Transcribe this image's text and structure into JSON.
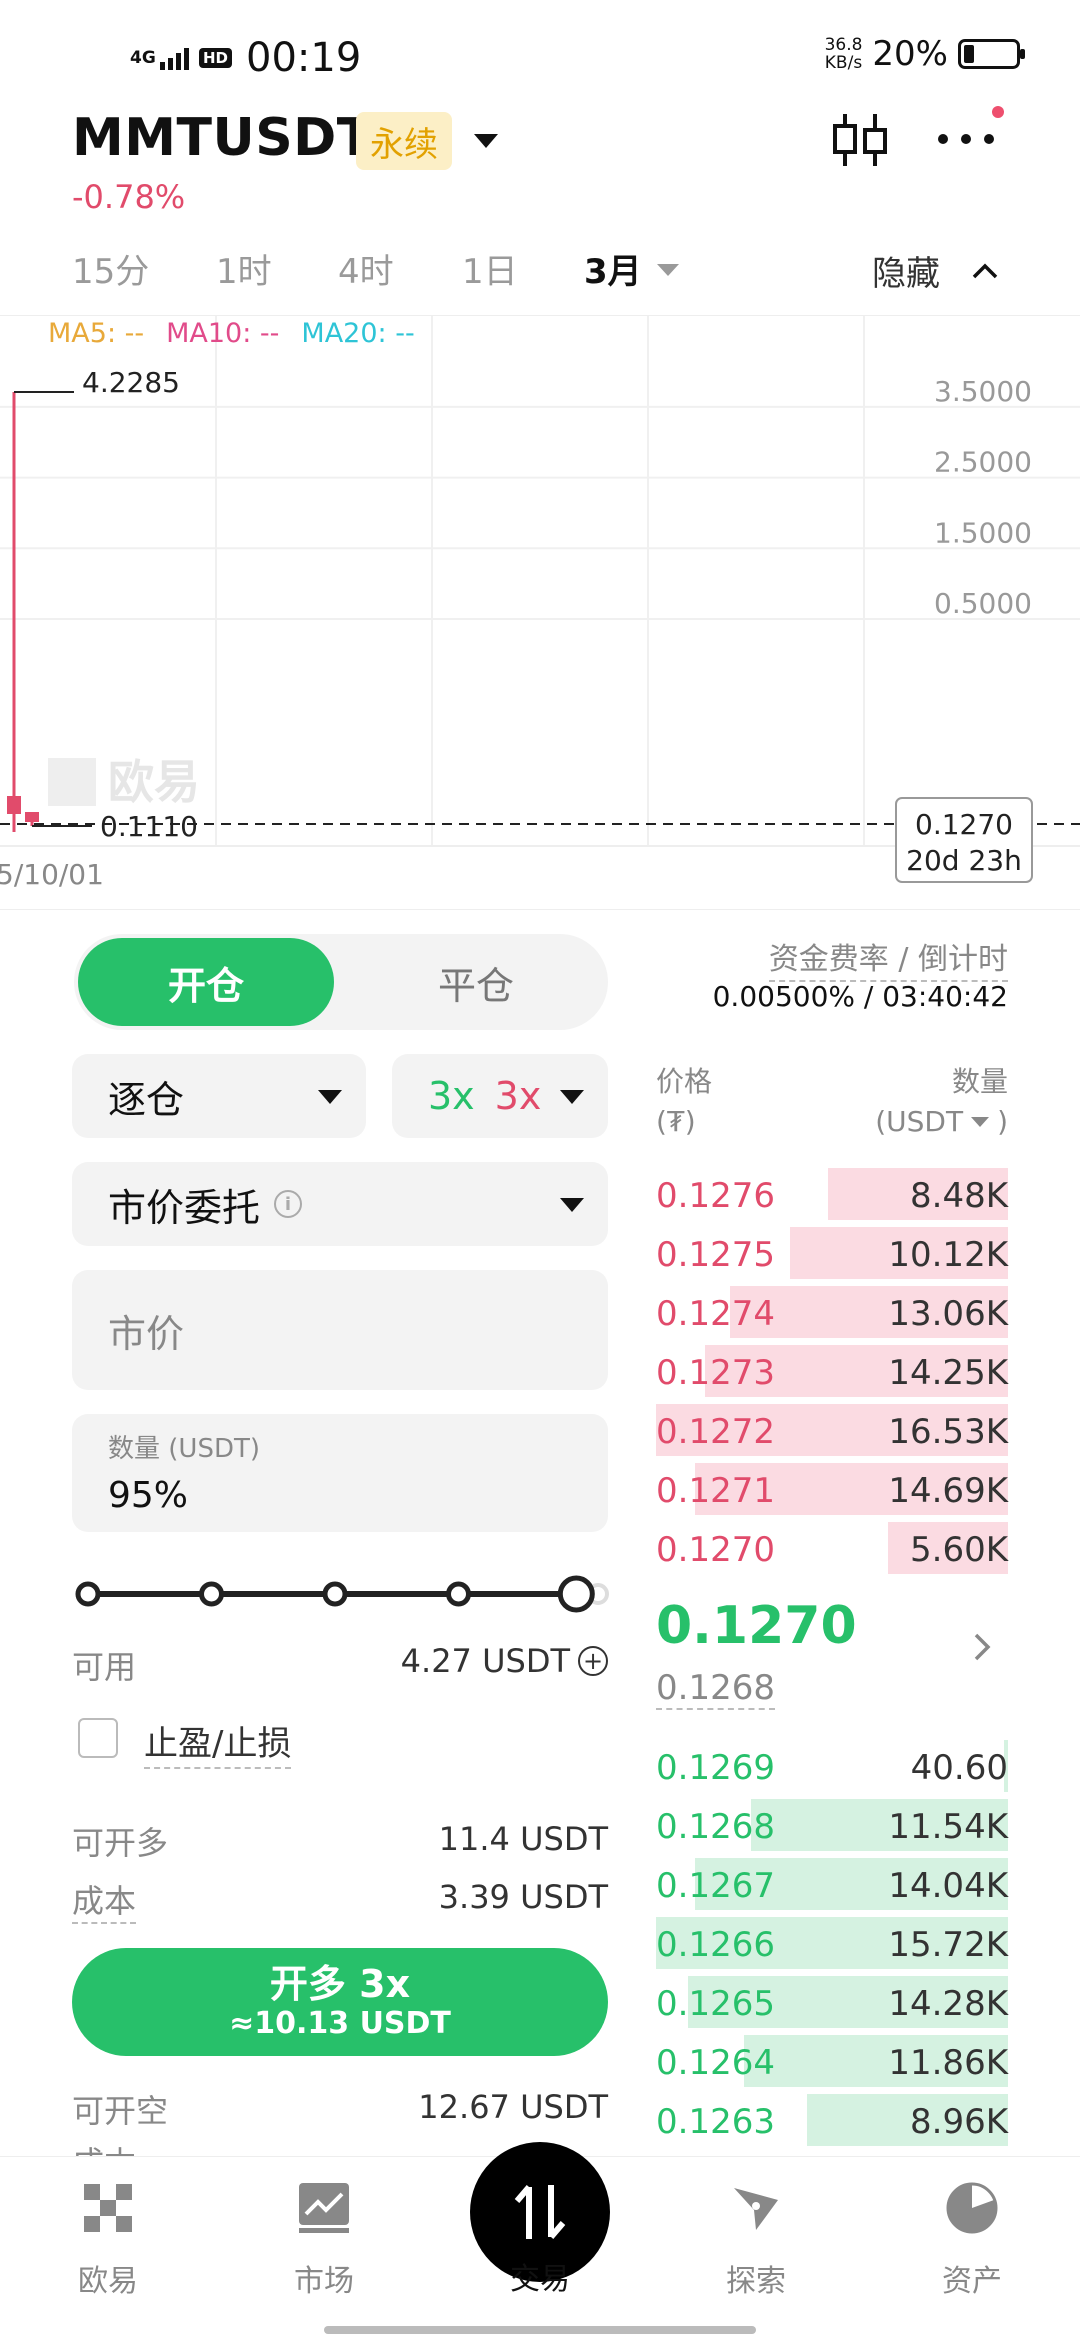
{
  "status_bar": {
    "network": "4G",
    "hd": "HD",
    "time": "00:19",
    "speed_value": "36.8",
    "speed_unit": "KB/s",
    "battery_pct": "20%",
    "battery_level": 0.2
  },
  "header": {
    "symbol": "MMTUSDT",
    "badge": "永续",
    "change": "-0.78%"
  },
  "timeframes": {
    "items": [
      "15分",
      "1时",
      "4时",
      "1日",
      "3月"
    ],
    "active_index": 4,
    "hide_label": "隐藏"
  },
  "chart": {
    "ma5": "MA5: --",
    "ma10": "MA10: --",
    "ma20": "MA20: --",
    "high_label": "4.2285",
    "low_label": "0.1110",
    "last_price": "0.1270",
    "countdown": "20d 23h",
    "date_label": "5/10/01",
    "watermark": "欧易",
    "colors": {
      "ma5": "#e8a93a",
      "ma10": "#e14b8a",
      "ma20": "#2ec4d6"
    }
  },
  "chart_data": {
    "type": "candlestick",
    "y_ticks": [
      3.5,
      2.5,
      1.5,
      0.5
    ],
    "y_tick_labels": [
      "3.5000",
      "2.5000",
      "1.5000",
      "0.5000"
    ],
    "ylim": [
      0.05,
      4.5
    ],
    "candles": [
      {
        "open": 0.2,
        "close": 0.13,
        "high": 4.2285,
        "low": 0.111
      },
      {
        "open": 0.13,
        "close": 0.127,
        "high": 0.14,
        "low": 0.12
      }
    ],
    "last_price": 0.127,
    "x_tick_labels": [
      "5/10/01"
    ]
  },
  "form": {
    "tab_open": "开仓",
    "tab_close": "平仓",
    "funding_label": "资金费率 / 倒计时",
    "funding_value": "0.00500% / 03:40:42",
    "margin_mode": "逐仓",
    "lev_long": "3x",
    "lev_short": "3x",
    "order_type": "市价委托",
    "info_glyph": "i",
    "price_placeholder": "市价",
    "qty_label": "数量 (USDT)",
    "qty_value": "95%",
    "slider_value": 0.95,
    "available_label": "可用",
    "available_value": "4.27 USDT",
    "tpsl_label": "止盈/止损",
    "long_max_label": "可开多",
    "long_max_value": "11.4 USDT",
    "cost_label": "成本",
    "cost_value": "3.39 USDT",
    "long_btn_title": "开多 3x",
    "long_btn_sub": "≈10.13 USDT",
    "short_max_label": "可开空",
    "short_max_value": "12.67 USDT",
    "short_cost_label": "成本"
  },
  "orderbook": {
    "price_header": "价格",
    "price_unit": "(₮)",
    "qty_header": "数量",
    "qty_unit": "(USDT",
    "qty_unit_close": ")",
    "asks": [
      {
        "price": "0.1276",
        "qty": "8.48K",
        "depth": 0.51
      },
      {
        "price": "0.1275",
        "qty": "10.12K",
        "depth": 0.62
      },
      {
        "price": "0.1274",
        "qty": "13.06K",
        "depth": 0.79
      },
      {
        "price": "0.1273",
        "qty": "14.25K",
        "depth": 0.86
      },
      {
        "price": "0.1272",
        "qty": "16.53K",
        "depth": 1.0
      },
      {
        "price": "0.1271",
        "qty": "14.69K",
        "depth": 0.89
      },
      {
        "price": "0.1270",
        "qty": "5.60K",
        "depth": 0.34
      }
    ],
    "mid_price": "0.1270",
    "mark_price": "0.1268",
    "bids": [
      {
        "price": "0.1269",
        "qty": "40.60",
        "depth": 0.01
      },
      {
        "price": "0.1268",
        "qty": "11.54K",
        "depth": 0.73
      },
      {
        "price": "0.1267",
        "qty": "14.04K",
        "depth": 0.89
      },
      {
        "price": "0.1266",
        "qty": "15.72K",
        "depth": 1.0
      },
      {
        "price": "0.1265",
        "qty": "14.28K",
        "depth": 0.91
      },
      {
        "price": "0.1264",
        "qty": "11.86K",
        "depth": 0.75
      },
      {
        "price": "0.1263",
        "qty": "8.96K",
        "depth": 0.57
      }
    ]
  },
  "nav": {
    "items": [
      {
        "label": "欧易",
        "icon": "okx-logo-icon"
      },
      {
        "label": "市场",
        "icon": "market-chart-icon"
      },
      {
        "label": "交易",
        "icon": "trade-swap-icon"
      },
      {
        "label": "探索",
        "icon": "compass-icon"
      },
      {
        "label": "资产",
        "icon": "pie-chart-icon"
      }
    ],
    "active_index": 2
  }
}
